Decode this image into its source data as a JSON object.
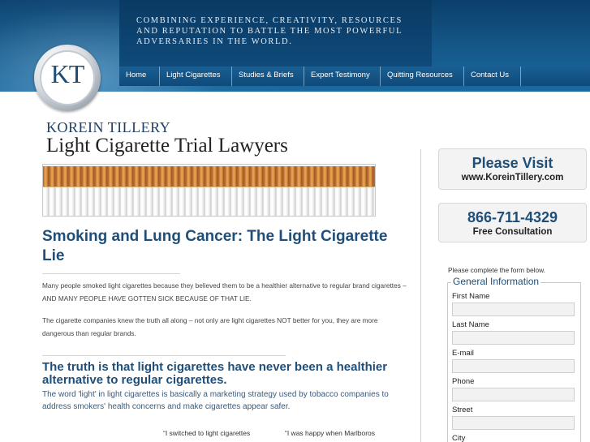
{
  "header": {
    "tagline": "Combining experience, creativity, resources and reputation to battle the most powerful adversaries in the world.",
    "nav": [
      {
        "label": "Home"
      },
      {
        "label": "Light Cigarettes"
      },
      {
        "label": "Studies & Briefs"
      },
      {
        "label": "Expert Testimony"
      },
      {
        "label": "Quitting Resources"
      },
      {
        "label": "Contact Us"
      }
    ]
  },
  "logo": {
    "text": "KT",
    "firm_name": "KOREIN TILLERY",
    "firm_subtitle": "Light Cigarette Trial Lawyers"
  },
  "main": {
    "heading": "Smoking and Lung Cancer: The Light Cigarette Lie",
    "paragraphs": [
      "Many people smoked light cigarettes because they believed them to be a healthier alternative to regular brand cigarettes – AND MANY PEOPLE HAVE GOTTEN SICK BECAUSE OF THAT LIE.",
      "The cigarette companies knew the truth all along – not only are light cigarettes NOT better for you, they are more dangerous than regular brands."
    ],
    "subheading": "The truth is that light cigarettes have never been a healthier alternative to regular cigarettes.",
    "subparagraph": "The word 'light' in light cigarettes is basically a marketing strategy used by tobacco companies to address smokers' health concerns and make cigarettes appear safer.",
    "quotes": [
      "“I switched to light cigarettes",
      "“I was happy when Marlboros"
    ]
  },
  "sidebar": {
    "visit": {
      "title": "Please Visit",
      "url": "www.KoreinTillery.com"
    },
    "phone": {
      "number": "866-711-4329",
      "note": "Free Consultation"
    },
    "form": {
      "intro": "Please complete the form below.",
      "legend": "General Information",
      "fields": [
        {
          "label": "First Name",
          "value": ""
        },
        {
          "label": "Last Name",
          "value": ""
        },
        {
          "label": "E-mail",
          "value": ""
        },
        {
          "label": "Phone",
          "value": ""
        },
        {
          "label": "Street",
          "value": ""
        },
        {
          "label": "City",
          "value": ""
        }
      ]
    }
  }
}
